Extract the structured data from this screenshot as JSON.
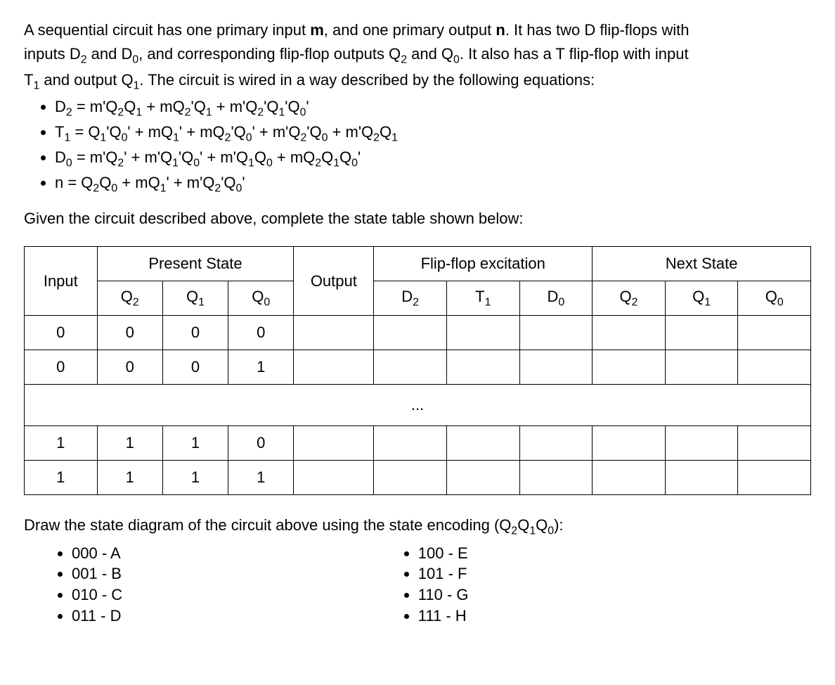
{
  "intro": {
    "l1a": "A sequential circuit has one primary input ",
    "l1b": "m",
    "l1c": ", and one primary output ",
    "l1d": "n",
    "l1e": ". It has two D flip-flops with",
    "l2a": "inputs D",
    "l2b": " and D",
    "l2c": ", and corresponding flip-flop outputs Q",
    "l2d": " and Q",
    "l2e": ". It also has a T flip-flop with input",
    "l3a": "T",
    "l3b": " and output Q",
    "l3c": ". The circuit is wired in a way described by the following equations:",
    "s2": "2",
    "s0": "0",
    "s1": "1"
  },
  "eq": {
    "d2a": "D",
    "d2b": " = m'Q",
    "d2c": "Q",
    "d2d": " + mQ",
    "d2e": "'Q",
    "d2f": " + m'Q",
    "d2g": "'Q",
    "d2h": "'Q",
    "d2i": "'",
    "t1a": "T",
    "t1b": " = Q",
    "t1c": "'Q",
    "t1d": "' + mQ",
    "t1e": "' + mQ",
    "t1f": "'Q",
    "t1g": "' + m'Q",
    "t1h": "'Q",
    "t1i": " + m'Q",
    "t1j": "Q",
    "d0a": "D",
    "d0b": " = m'Q",
    "d0c": "' + m'Q",
    "d0d": "'Q",
    "d0e": "' + m'Q",
    "d0f": "Q",
    "d0g": " + mQ",
    "d0h": "Q",
    "d0i": "Q",
    "d0j": "'",
    "na": "n = Q",
    "nb": "Q",
    "nc": " + mQ",
    "nd": "' + m'Q",
    "ne": "'Q",
    "nf": "'"
  },
  "prompt": "Given the circuit described above, complete the state table shown below:",
  "table": {
    "hdr_present": "Present State",
    "hdr_ff": "Flip-flop excitation",
    "hdr_next": "Next State",
    "input": "Input",
    "q2": "Q",
    "q1": "Q",
    "q0": "Q",
    "output": "Output",
    "d2": "D",
    "t1": "T",
    "d0": "D",
    "rows": [
      {
        "in": "0",
        "q2": "0",
        "q1": "0",
        "q0": "0"
      },
      {
        "in": "0",
        "q2": "0",
        "q1": "0",
        "q0": "1"
      }
    ],
    "ellipsis": "...",
    "rows2": [
      {
        "in": "1",
        "q2": "1",
        "q1": "1",
        "q0": "0"
      },
      {
        "in": "1",
        "q2": "1",
        "q1": "1",
        "q0": "1"
      }
    ]
  },
  "draw": {
    "prompt_a": "Draw the state diagram of the circuit above using the state encoding (Q",
    "prompt_b": "Q",
    "prompt_c": "Q",
    "prompt_d": "):",
    "codes_left": [
      "000 - A",
      "001 - B",
      "010 - C",
      "011 - D"
    ],
    "codes_right": [
      "100 - E",
      "101 - F",
      "110 - G",
      "111 - H"
    ]
  }
}
